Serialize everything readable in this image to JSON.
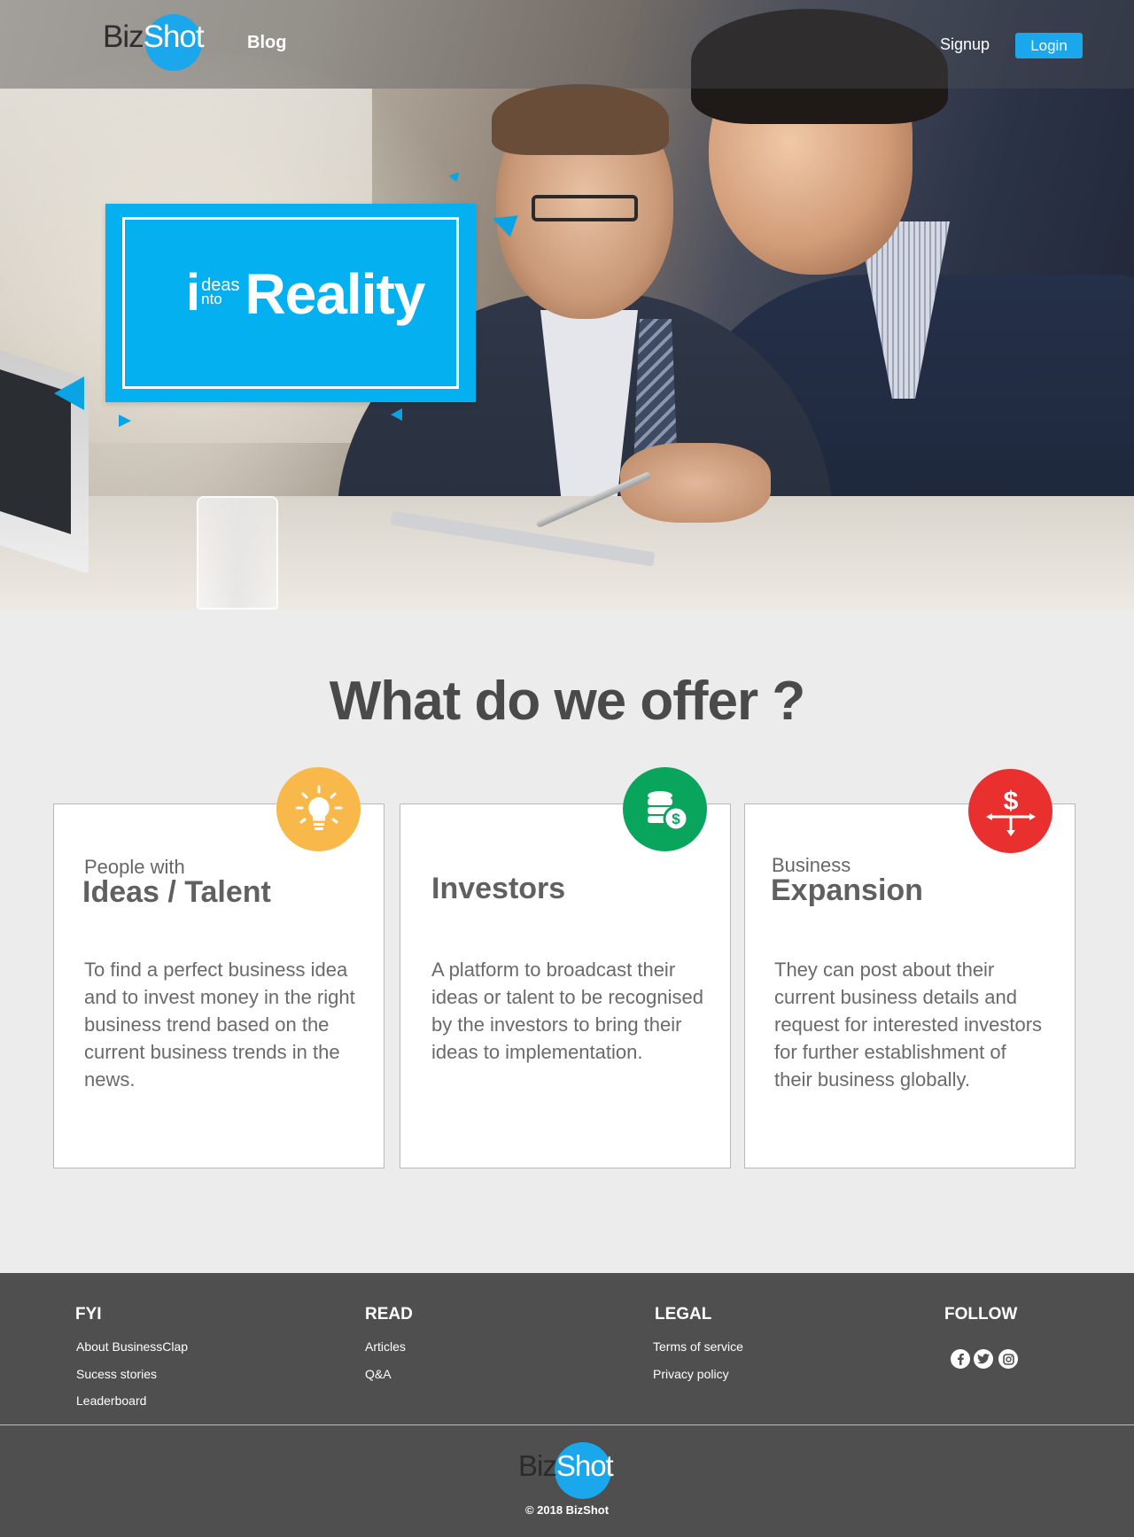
{
  "nav": {
    "logo_biz": "Biz",
    "logo_shot": "Shot",
    "blog": "Blog",
    "signup": "Signup",
    "login": "Login"
  },
  "hero": {
    "tagline_i": "i",
    "tagline_deas": "deas",
    "tagline_nto": "nto",
    "tagline_reality": "Reality",
    "accent_color": "#05b0f0"
  },
  "offer": {
    "title": "What do we offer ?",
    "cards": [
      {
        "small": "People with",
        "big": "Ideas / Talent",
        "desc": "To find a perfect business idea and to invest money in the right business trend based on the current business trends in the news.",
        "icon": "lightbulb-icon",
        "color": "#f9b94a"
      },
      {
        "small": "",
        "big": "Investors",
        "desc": "A platform to broadcast their ideas or talent to be recognised by the investors to bring their ideas to implementation.",
        "icon": "coins-icon",
        "color": "#0aa55c"
      },
      {
        "small": "Business",
        "big": "Expansion",
        "desc": "They can post about their current business details and request for interested investors for further establishment of their business globally.",
        "icon": "dollar-expansion-icon",
        "color": "#ea2f2f"
      }
    ]
  },
  "footer": {
    "fyi": {
      "title": "FYI",
      "links": [
        "About BusinessClap",
        "Sucess stories",
        "Leaderboard"
      ]
    },
    "read": {
      "title": "READ",
      "links": [
        "Articles",
        "Q&A"
      ]
    },
    "legal": {
      "title": "LEGAL",
      "links": [
        "Terms of service",
        "Privacy policy"
      ]
    },
    "follow": {
      "title": "FOLLOW",
      "icons": [
        "facebook-icon",
        "twitter-icon",
        "instagram-icon"
      ]
    },
    "logo_biz": "Biz",
    "logo_shot": "Shot",
    "copyright": "© 2018 BizShot"
  }
}
